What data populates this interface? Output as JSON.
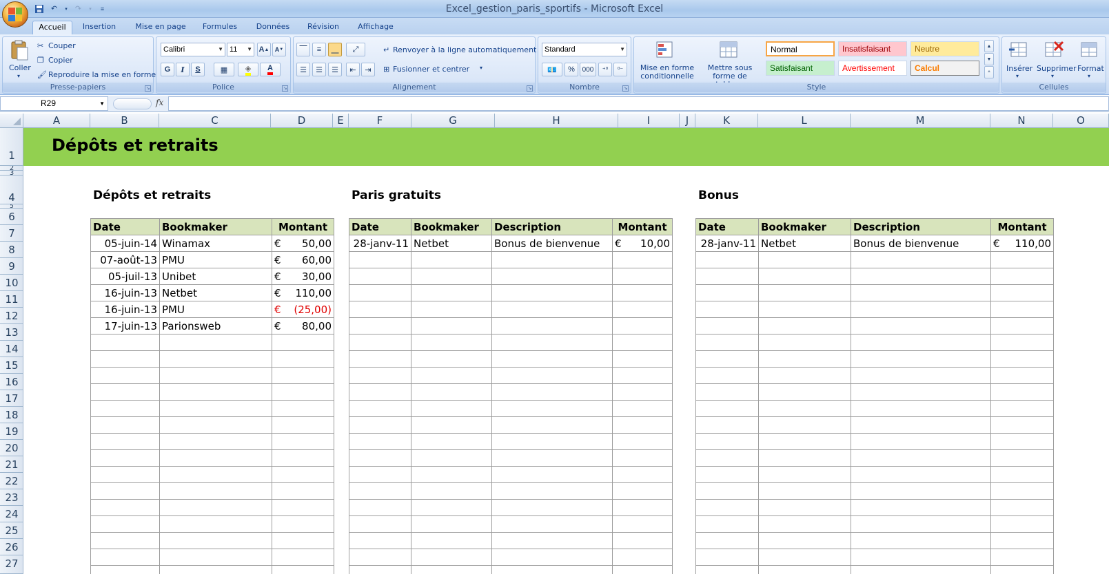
{
  "window": {
    "title": "Excel_gestion_paris_sportifs - Microsoft Excel"
  },
  "tabs": [
    "Accueil",
    "Insertion",
    "Mise en page",
    "Formules",
    "Données",
    "Révision",
    "Affichage"
  ],
  "ribbon": {
    "clipboard": {
      "paste": "Coller",
      "cut": "Couper",
      "copy": "Copier",
      "format_painter": "Reproduire la mise en forme",
      "label": "Presse-papiers"
    },
    "font": {
      "name": "Calibri",
      "size": "11",
      "bold": "G",
      "italic": "I",
      "underline": "S",
      "label": "Police"
    },
    "alignment": {
      "wrap": "Renvoyer à la ligne automatiquement",
      "merge": "Fusionner et centrer",
      "label": "Alignement"
    },
    "number": {
      "format": "Standard",
      "percent": "%",
      "thousands": "000",
      "label": "Nombre"
    },
    "style": {
      "conditional": "Mise en forme conditionnelle",
      "table": "Mettre sous forme de tableau",
      "cells": [
        {
          "name": "Normal",
          "bg": "#ffffff",
          "fg": "#000000"
        },
        {
          "name": "Insatisfaisant",
          "bg": "#ffc7ce",
          "fg": "#9c0006"
        },
        {
          "name": "Neutre",
          "bg": "#ffeb9c",
          "fg": "#9c6500"
        },
        {
          "name": "Satisfaisant",
          "bg": "#c6efce",
          "fg": "#006100"
        },
        {
          "name": "Avertissement",
          "bg": "#ffffff",
          "fg": "#ff0000"
        },
        {
          "name": "Calcul",
          "bg": "#f2f2f2",
          "fg": "#fa7d00"
        }
      ],
      "label": "Style"
    },
    "cells": {
      "insert": "Insérer",
      "delete": "Supprimer",
      "format": "Format",
      "label": "Cellules"
    }
  },
  "formula_bar": {
    "name_box": "R29",
    "fx": "fx",
    "value": ""
  },
  "columns": [
    "A",
    "B",
    "C",
    "D",
    "E",
    "F",
    "G",
    "H",
    "I",
    "J",
    "K",
    "L",
    "M",
    "N",
    "O"
  ],
  "rows": [
    "1",
    "2",
    "3",
    "4",
    "5",
    "6",
    "7",
    "8",
    "9",
    "10",
    "11",
    "12",
    "13",
    "14",
    "15",
    "16",
    "17",
    "18",
    "19",
    "20",
    "21",
    "22",
    "23",
    "24",
    "25",
    "26",
    "27"
  ],
  "sheet": {
    "banner_title": "Dépôts et retraits",
    "deposits": {
      "title": "Dépôts et retraits",
      "headers": [
        "Date",
        "Bookmaker",
        "Montant"
      ],
      "rows": [
        {
          "date": "05-juin-14",
          "bookmaker": "Winamax",
          "currency": "€",
          "amount": "50,00",
          "negative": false
        },
        {
          "date": "07-août-13",
          "bookmaker": "PMU",
          "currency": "€",
          "amount": "60,00",
          "negative": false
        },
        {
          "date": "05-juil-13",
          "bookmaker": "Unibet",
          "currency": "€",
          "amount": "30,00",
          "negative": false
        },
        {
          "date": "16-juin-13",
          "bookmaker": "Netbet",
          "currency": "€",
          "amount": "110,00",
          "negative": false
        },
        {
          "date": "16-juin-13",
          "bookmaker": "PMU",
          "currency": "€",
          "amount": "(25,00)",
          "negative": true
        },
        {
          "date": "17-juin-13",
          "bookmaker": "Parionsweb",
          "currency": "€",
          "amount": "80,00",
          "negative": false
        }
      ]
    },
    "free_bets": {
      "title": "Paris gratuits",
      "headers": [
        "Date",
        "Bookmaker",
        "Description",
        "Montant"
      ],
      "rows": [
        {
          "date": "28-janv-11",
          "bookmaker": "Netbet",
          "description": "Bonus de bienvenue",
          "currency": "€",
          "amount": "10,00"
        }
      ]
    },
    "bonus": {
      "title": "Bonus",
      "headers": [
        "Date",
        "Bookmaker",
        "Description",
        "Montant"
      ],
      "rows": [
        {
          "date": "28-janv-11",
          "bookmaker": "Netbet",
          "description": "Bonus de bienvenue",
          "currency": "€",
          "amount": "110,00"
        }
      ]
    }
  }
}
